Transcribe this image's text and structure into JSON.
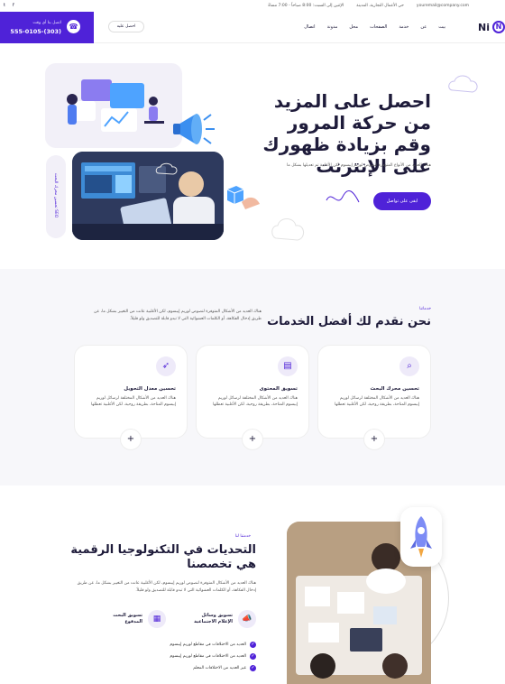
{
  "topbar": {
    "email": "youremail@company.com",
    "address": "حي الأعمال التجارية، المدينة",
    "hours": "الإثنين إلى السبت: 8:00 صباحاً - 7:00 مساءً"
  },
  "callbox": {
    "label": "اتصل بنا أي وقت",
    "phone": "555-0105-(303)"
  },
  "nav": {
    "logo_text": "Ni",
    "items": [
      "بيت",
      "عن",
      "خدمة",
      "الصفحات",
      "محل",
      "مدونة",
      "اتصال"
    ],
    "cta_label": "احصل عليه"
  },
  "hero": {
    "title": "احصل على المزيد من حركة المرور وقم بزيادة ظهورك على الإنترنت",
    "description": "هناك العديد من الأنواع المتوفرة لنصوص لوريم إيبسوم لكن الأغلبية تم تعديلها بشكل ما",
    "button_label": "ابقى على تواصل",
    "side_badge": "SEO تحسين محرك البحث"
  },
  "services": {
    "kicker": "خدماتنا",
    "title": "نحن نقدم لك أفضل الخدمات",
    "description": "هناك العديد من الأشكال المتوفرة لنصوص لوريم إيبسوم، لكن الأغلبية عانت من التغيير بشكل ما، عن طريق إدخال الفكاهة، أو الكلمات العشوائية التي لا تبدو قابلة للتصديق ولو قليلاً.",
    "cards": [
      {
        "title": "تحسين محرك البحث",
        "desc": "هناك العديد من الأشكال المختلفة لرسائل لوريم إيبسوم المتاحة، بطريقة روحية، لكن الأغلبية تعطلها",
        "icon": "search-icon"
      },
      {
        "title": "تسويق المحتوى",
        "desc": "هناك العديد من الأشكال المختلفة لرسائل لوريم إيبسوم المتاحة، بطريقة روحية، لكن الأغلبية تعطلها",
        "icon": "document-icon"
      },
      {
        "title": "تحسين معدل التحويل",
        "desc": "هناك العديد من الأشكال المختلفة لرسائل لوريم إيبسوم المتاحة، بطريقة روحية، لكن الأغلبية تعطلها",
        "icon": "rocket-icon"
      }
    ]
  },
  "challenges": {
    "kicker": "خدمتنا لنا",
    "title": "التحديات في التكنولوجيا الرقمية هي تخصصنا",
    "description": "هناك العديد من الأشكال المتوفرة لنصوص لوريم إيبسوم، لكن الأغلبية عانت من التغيير بشكل ما، عن طريق إدخال الفكاهة، أو الكلمات العشوائية التي لا تبدو قابلة للتصديق ولو قليلاً.",
    "features": [
      {
        "label": "تسويق وسائل الإعلام الاجتماعية",
        "icon": "megaphone-icon"
      },
      {
        "label": "تسويق البحث المدفوع",
        "icon": "chart-icon"
      }
    ],
    "checklist": [
      "العديد من الاختلافات في مقاطع لوريم إيبسوم",
      "العديد من الاختلافات في مقاطع لوريم إيبسوم",
      "غير العديد من الاختلافات المعلم"
    ]
  },
  "colors": {
    "primary": "#4f22d8",
    "text": "#1e1b3a",
    "soft": "#eeeaf9"
  }
}
